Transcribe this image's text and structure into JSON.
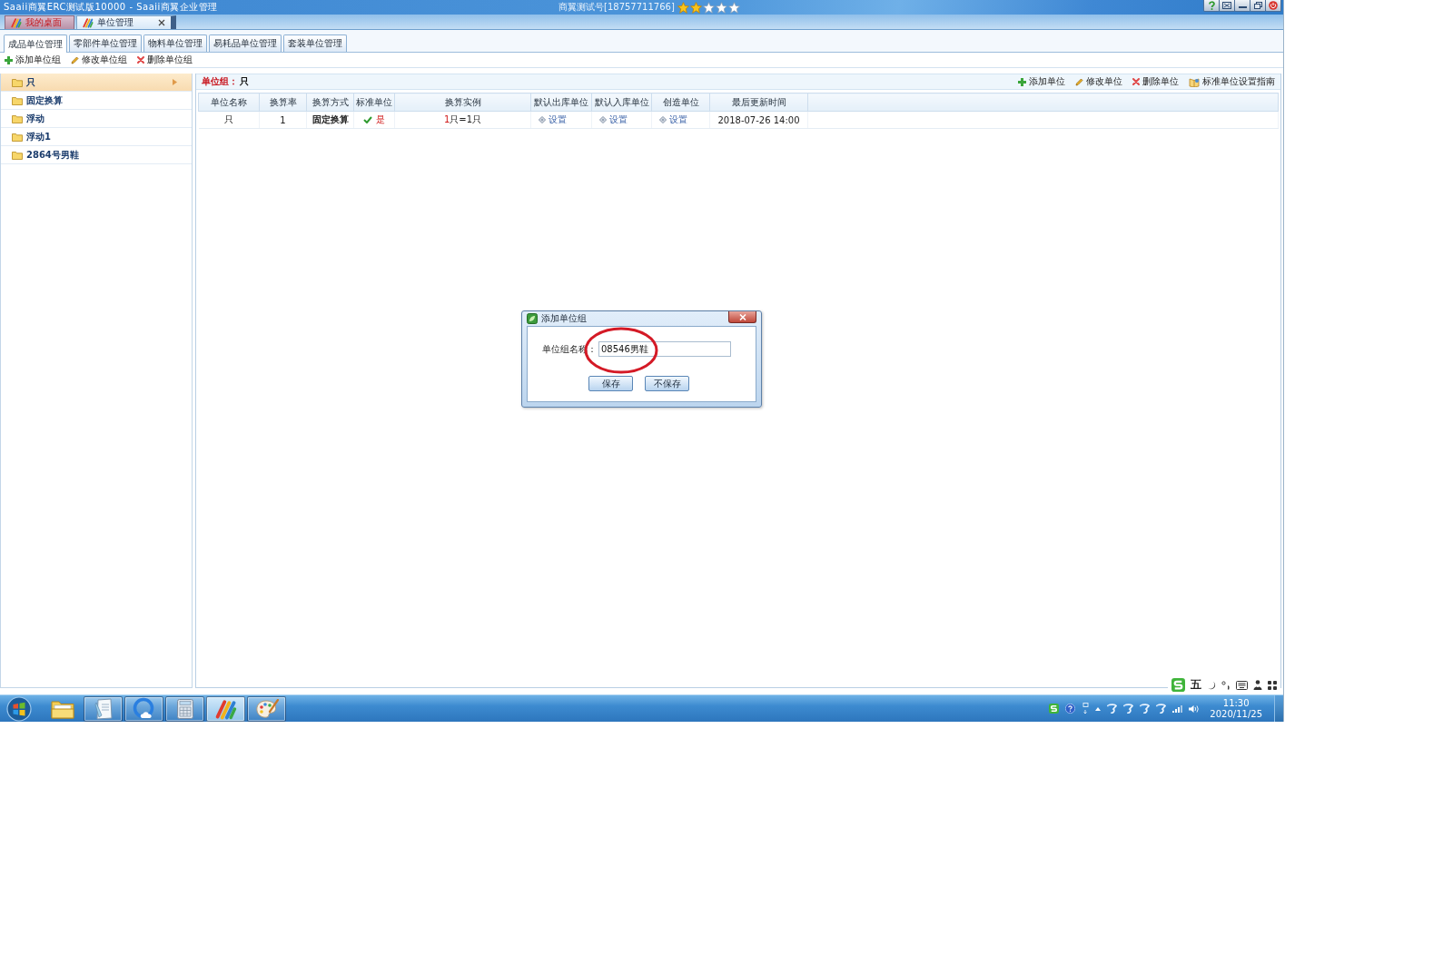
{
  "window": {
    "title": "Saaii商翼ERC测试版10000 - Saaii商翼企业管理",
    "account": "商翼测试号[18757711766]",
    "stars": 2
  },
  "doc_tabs": [
    {
      "label": "我的桌面",
      "selected": false,
      "closable": false
    },
    {
      "label": "单位管理",
      "selected": true,
      "closable": true
    }
  ],
  "module_tabs": [
    {
      "label": "成品单位管理",
      "selected": true
    },
    {
      "label": "零部件单位管理",
      "selected": false
    },
    {
      "label": "物料单位管理",
      "selected": false
    },
    {
      "label": "易耗品单位管理",
      "selected": false
    },
    {
      "label": "套装单位管理",
      "selected": false
    }
  ],
  "toolbar": [
    {
      "kind": "add",
      "label": "添加单位组"
    },
    {
      "kind": "edit",
      "label": "修改单位组"
    },
    {
      "kind": "delete",
      "label": "删除单位组"
    }
  ],
  "sidebar": {
    "items": [
      {
        "label": "只",
        "selected": true
      },
      {
        "label": "固定换算",
        "selected": false
      },
      {
        "label": "浮动",
        "selected": false
      },
      {
        "label": "浮动1",
        "selected": false
      },
      {
        "label": "2864号男鞋",
        "selected": false
      }
    ]
  },
  "unit_group": {
    "label": "单位组：",
    "value": "只"
  },
  "actions": [
    {
      "kind": "add",
      "label": "添加单位"
    },
    {
      "kind": "edit",
      "label": "修改单位"
    },
    {
      "kind": "delete",
      "label": "删除单位"
    },
    {
      "kind": "guide",
      "label": "标准单位设置指南"
    }
  ],
  "table": {
    "columns": [
      "单位名称",
      "换算率",
      "换算方式",
      "标准单位",
      "换算实例",
      "默认出库单位",
      "默认入库单位",
      "创造单位",
      "最后更新时间"
    ],
    "rows": [
      {
        "cells": [
          {
            "kind": "text",
            "text": "只"
          },
          {
            "kind": "text",
            "text": "1"
          },
          {
            "kind": "bold",
            "text": "固定换算"
          },
          {
            "kind": "flag",
            "text": "是",
            "checked": true
          },
          {
            "kind": "example",
            "qty": "1",
            "text": "只=1只"
          },
          {
            "kind": "link",
            "text": "设置"
          },
          {
            "kind": "link",
            "text": "设置"
          },
          {
            "kind": "link",
            "text": "设置"
          },
          {
            "kind": "text",
            "text": "2018-07-26 14:00"
          }
        ]
      }
    ]
  },
  "dialog": {
    "title": "添加单位组",
    "field_label": "单位组名称：",
    "value": "08546男鞋",
    "buttons": [
      "保存",
      "不保存"
    ]
  },
  "ime": {
    "mode": "五"
  },
  "taskbar": {
    "apps": [
      {
        "kind": "folder",
        "running": false,
        "selected": false
      },
      {
        "kind": "notepad",
        "running": true,
        "selected": false
      },
      {
        "kind": "browser",
        "running": true,
        "selected": false
      },
      {
        "kind": "calculator",
        "running": true,
        "selected": false
      },
      {
        "kind": "app",
        "running": true,
        "selected": true
      },
      {
        "kind": "paint",
        "running": true,
        "selected": false
      }
    ],
    "clock": {
      "time": "11:30",
      "date": "2020/11/25"
    }
  }
}
